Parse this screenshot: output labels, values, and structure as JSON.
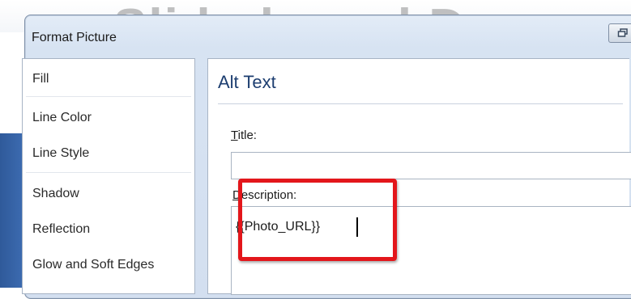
{
  "dialog": {
    "title": "Format Picture",
    "background_slide_text": "Slide-based De"
  },
  "nav": {
    "items": [
      {
        "label": "Fill"
      },
      {
        "label": "Line Color"
      },
      {
        "label": "Line Style"
      },
      {
        "label": "Shadow"
      },
      {
        "label": "Reflection"
      },
      {
        "label": "Glow and Soft Edges"
      }
    ]
  },
  "content": {
    "heading": "Alt Text",
    "title_field": {
      "label_mnemonic": "T",
      "label_rest": "itle:",
      "value": ""
    },
    "description_field": {
      "label_mnemonic": "D",
      "label_rest": "escription:",
      "value": "{{Photo_URL}}"
    }
  },
  "colors": {
    "highlight": "#e3161b",
    "heading": "#1d3e70",
    "slide_accent": "#3e6db3"
  }
}
